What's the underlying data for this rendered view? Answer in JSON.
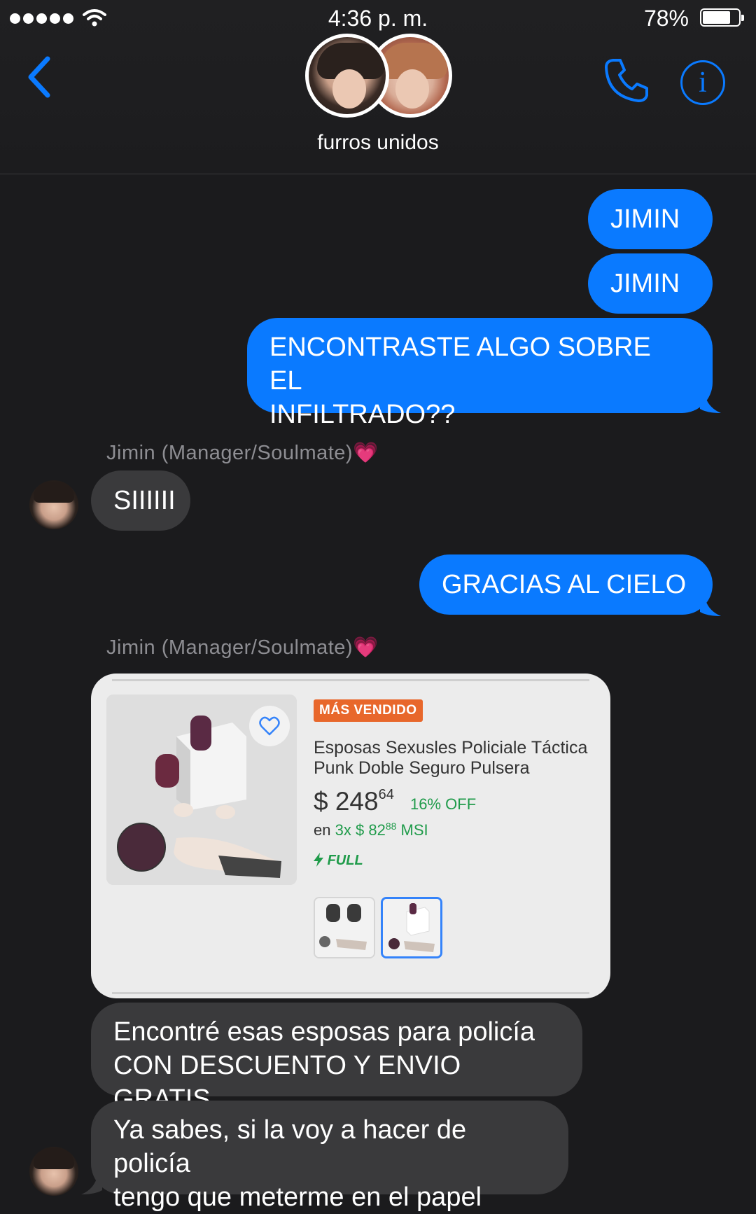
{
  "status_bar": {
    "time": "4:36 p. m.",
    "battery_percent": "78%",
    "battery_level": 0.78
  },
  "header": {
    "group_name": "furros unidos",
    "back_icon": "chevron-left-icon",
    "call_icon": "phone-icon",
    "info_icon": "info-icon",
    "info_glyph": "i"
  },
  "colors": {
    "outgoing_bubble": "#0a7aff",
    "incoming_bubble": "#3a3a3c",
    "background": "#1b1b1d"
  },
  "messages": [
    {
      "direction": "outgoing",
      "text": "JIMIN"
    },
    {
      "direction": "outgoing",
      "text": "JIMIN"
    },
    {
      "direction": "outgoing",
      "text": "ENCONTRASTE ALGO SOBRE EL INFILTRADO??",
      "lines": [
        "ENCONTRASTE ALGO SOBRE EL",
        "INFILTRADO??"
      ]
    },
    {
      "direction": "incoming",
      "sender": "Jimin (Manager/Soulmate)💗",
      "text": "SIIIIII"
    },
    {
      "direction": "outgoing",
      "text": "GRACIAS AL CIELO"
    },
    {
      "direction": "incoming",
      "sender": "Jimin (Manager/Soulmate)💗",
      "type": "product-card"
    },
    {
      "direction": "incoming",
      "text": "Encontré esas esposas para policía CON DESCUENTO Y ENVIO GRATIS",
      "lines": [
        "Encontré esas esposas para policía",
        "CON DESCUENTO Y ENVIO GRATIS"
      ]
    },
    {
      "direction": "incoming",
      "text": "Ya sabes, si la voy a hacer de policía tengo que meterme en el papel",
      "lines": [
        "Ya sabes, si la voy a hacer de policía",
        "tengo que meterme en el papel"
      ]
    }
  ],
  "product": {
    "badge": "MÁS VENDIDO",
    "title": "Esposas Sexusles Policiale Táctica Punk Doble Seguro Pulsera",
    "price_currency": "$",
    "price_int": "248",
    "price_cents": "64",
    "discount": "16% OFF",
    "installments_prefix": "en",
    "installments_count": "3x",
    "installment_int": "$ 82",
    "installment_cents": "88",
    "installments_suffix": "MSI",
    "shipping_label": "FULL",
    "favorite_icon": "heart-outline-icon",
    "selected_thumbnail_index": 1
  }
}
